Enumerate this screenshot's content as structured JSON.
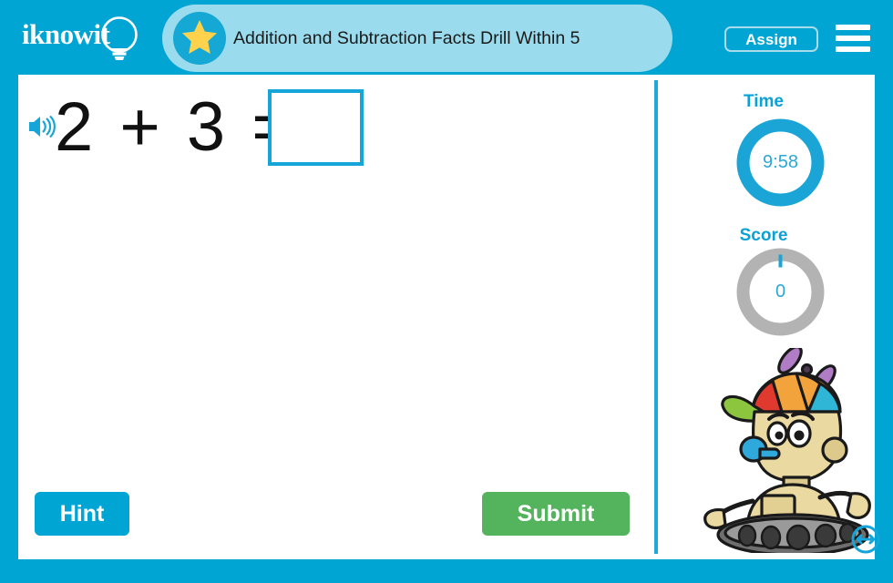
{
  "header": {
    "logo_text": "iknowit",
    "logo_icon": "lightbulb-icon",
    "star_icon": "star-icon",
    "title": "Addition and Subtraction Facts Drill Within 5",
    "assign_label": "Assign",
    "menu_icon": "hamburger-menu-icon"
  },
  "problem": {
    "speaker_icon": "speaker-audio-icon",
    "expression": "2 + 3 =",
    "operand_left": "2",
    "operator": "+",
    "operand_right": "3",
    "equals": "=",
    "answer_value": "",
    "answer_placeholder": ""
  },
  "actions": {
    "hint_label": "Hint",
    "submit_label": "Submit"
  },
  "sidebar": {
    "time_label": "Time",
    "time_value": "9:58",
    "score_label": "Score",
    "score_value": "0",
    "mascot_icon": "robot-mascot-icon",
    "resize_icon": "resize-horizontal-icon"
  },
  "colors": {
    "frame_blue": "#00a5d4",
    "title_pill_blue": "#9adced",
    "accent_blue": "#16a5d8",
    "submit_green": "#54b45d",
    "score_ring_gray": "#b3b3b3",
    "star_gold": "#ffd24d"
  }
}
